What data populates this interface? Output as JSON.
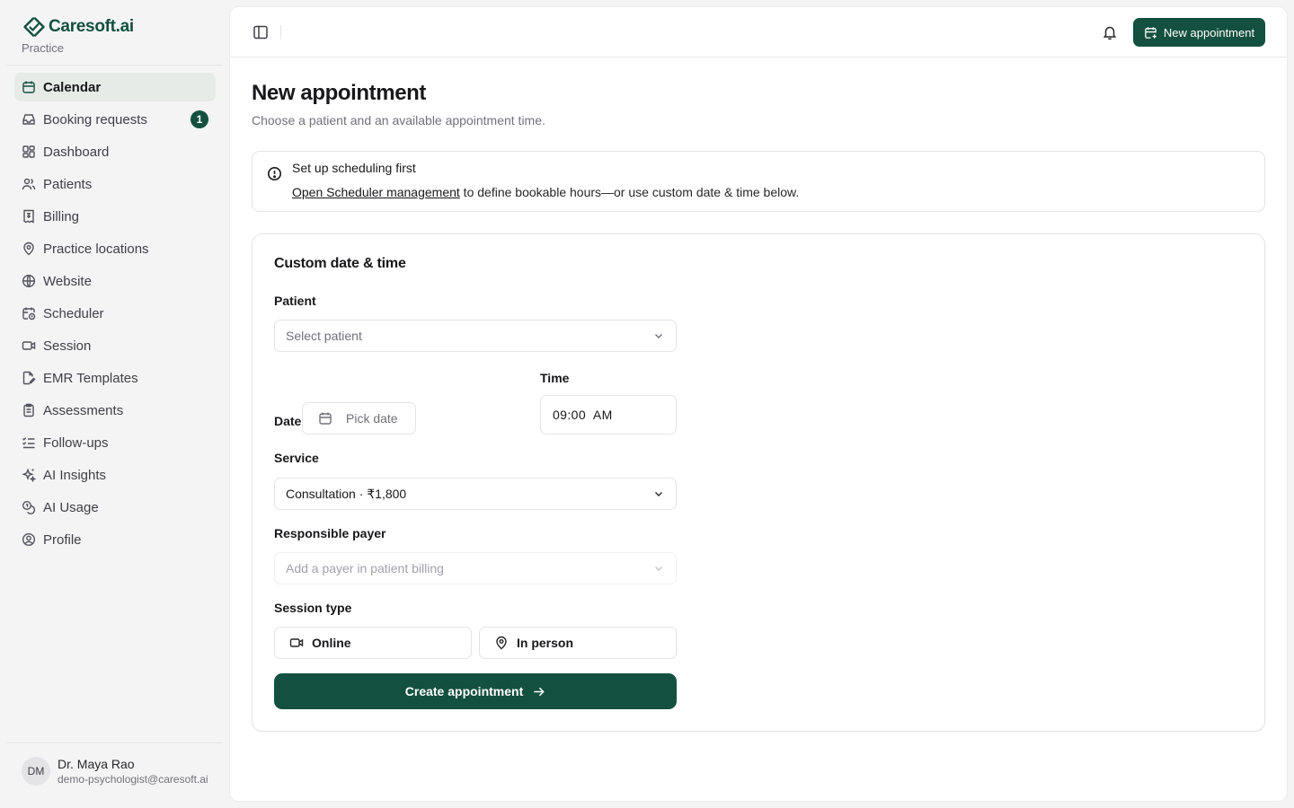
{
  "brand": {
    "name": "Caresoft.ai",
    "subtitle": "Practice",
    "color": "#14503f"
  },
  "sidebar": {
    "items": [
      {
        "label": "Calendar",
        "icon": "calendar-icon",
        "active": true
      },
      {
        "label": "Booking requests",
        "icon": "inbox-icon",
        "badge": "1"
      },
      {
        "label": "Dashboard",
        "icon": "dashboard-icon"
      },
      {
        "label": "Patients",
        "icon": "users-icon"
      },
      {
        "label": "Billing",
        "icon": "receipt-icon"
      },
      {
        "label": "Practice locations",
        "icon": "map-pin-icon"
      },
      {
        "label": "Website",
        "icon": "globe-icon"
      },
      {
        "label": "Scheduler",
        "icon": "calendar-clock-icon"
      },
      {
        "label": "Session",
        "icon": "video-icon"
      },
      {
        "label": "EMR Templates",
        "icon": "file-pen-icon"
      },
      {
        "label": "Assessments",
        "icon": "clipboard-icon"
      },
      {
        "label": "Follow-ups",
        "icon": "list-checks-icon"
      },
      {
        "label": "AI Insights",
        "icon": "sparkles-icon"
      },
      {
        "label": "AI Usage",
        "icon": "coins-icon"
      },
      {
        "label": "Profile",
        "icon": "user-circle-icon"
      }
    ]
  },
  "user": {
    "initials": "DM",
    "name": "Dr. Maya Rao",
    "email": "demo-psychologist@caresoft.ai"
  },
  "topbar": {
    "new_button": "New appointment"
  },
  "page": {
    "title": "New appointment",
    "subtitle": "Choose a patient and an available appointment time."
  },
  "alert": {
    "title": "Set up scheduling first",
    "link": "Open Scheduler management",
    "body": " to define bookable hours—or use custom date & time below."
  },
  "form": {
    "title": "Custom date & time",
    "patient_label": "Patient",
    "patient_placeholder": "Select patient",
    "date_label": "Date",
    "date_placeholder": "Pick date",
    "time_label": "Time",
    "time_value": "09:00  AM",
    "service_label": "Service",
    "service_value": "Consultation · ₹1,800",
    "payer_label": "Responsible payer",
    "payer_placeholder": "Add a payer in patient billing",
    "session_type_label": "Session type",
    "session_online": "Online",
    "session_in_person": "In person",
    "submit": "Create appointment"
  }
}
